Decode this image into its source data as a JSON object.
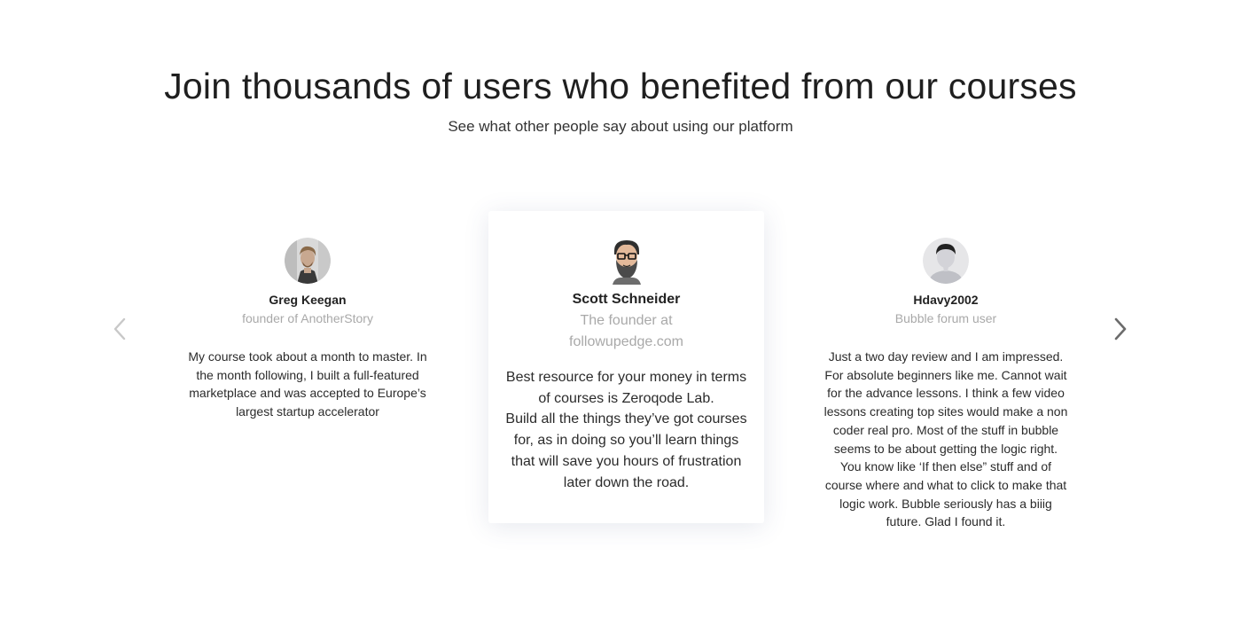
{
  "section": {
    "title": "Join thousands of users who benefited from our courses",
    "subtitle": "See what other people say about using our platform"
  },
  "carousel": {
    "prev_icon": "chevron-left-icon",
    "next_icon": "chevron-right-icon",
    "arrow_colors": {
      "prev": "#c8c8c8",
      "next": "#6b6b6b"
    }
  },
  "testimonials": [
    {
      "name": "Greg Keegan",
      "role": "founder of AnotherStory",
      "quote": "My course took about a month to master. In the month following, I built a full-featured marketplace and was accepted to Europe’s largest startup accelerator",
      "avatar": "avatar-photo-icon"
    },
    {
      "name": "Scott Schneider",
      "role": "The founder at followupedge.com",
      "quote": "Best resource for your money in terms of courses is Zeroqode Lab.\nBuild all the things they’ve got courses for, as in doing so you’ll learn things that will save you hours of frustration later down the road.",
      "avatar": "bearded-man-avatar-icon"
    },
    {
      "name": "Hdavy2002",
      "role": "Bubble forum user",
      "quote": "Just a two day review and I am impressed. For absolute beginners like me. Cannot wait for the advance lessons. I think a few video lessons creating top sites would make a non coder real pro. Most of the stuff in bubble seems to be about getting the logic right. You know like ‘If then else” stuff and of course where and what to click to make that logic work. Bubble seriously has a biiig future. Glad I found it.",
      "avatar": "default-user-avatar-icon"
    }
  ],
  "colors": {
    "background": "#ffffff",
    "heading": "#1f1f1f",
    "muted": "#a9a9a9",
    "text": "#2b2b2b"
  }
}
